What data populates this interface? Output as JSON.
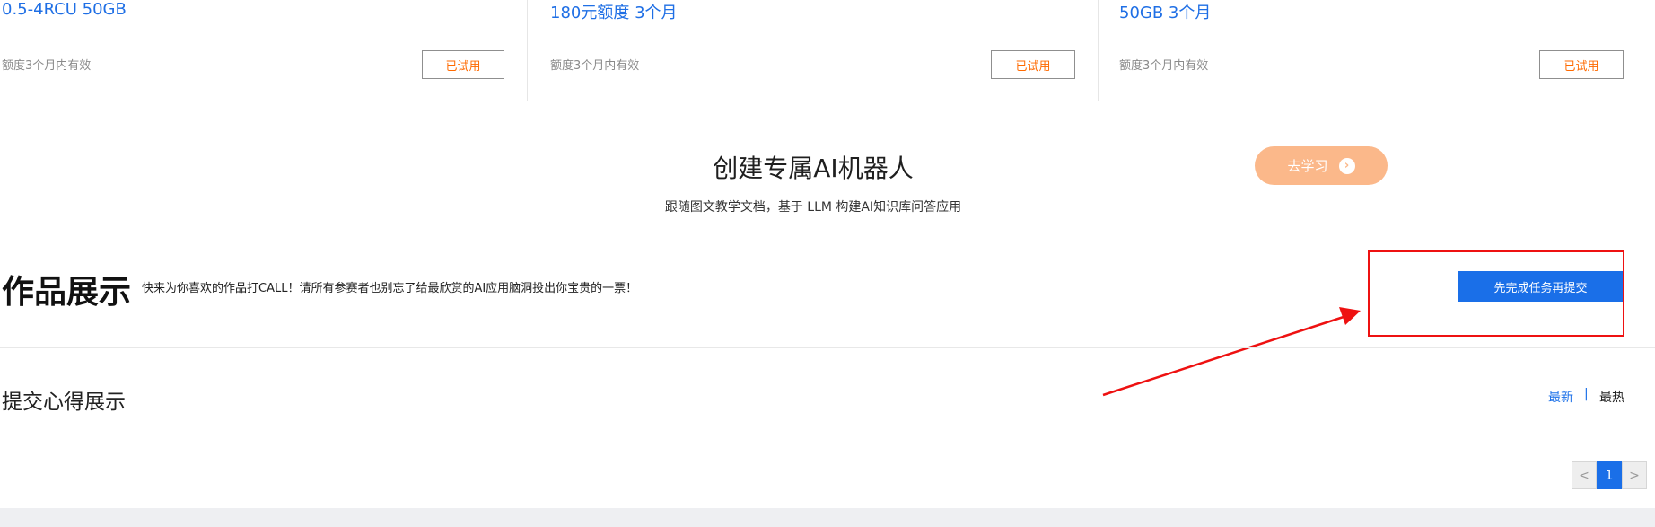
{
  "cards": [
    {
      "title": "0.5-4RCU 50GB",
      "note": "额度3个月内有效",
      "button": "已试用"
    },
    {
      "title": "180元额度 3个月",
      "note": "额度3个月内有效",
      "button": "已试用"
    },
    {
      "title": "50GB 3个月",
      "note": "额度3个月内有效",
      "button": "已试用"
    }
  ],
  "promo": {
    "title": "创建专属AI机器人",
    "subtitle": "跟随图文教学文档，基于 LLM 构建AI知识库问答应用",
    "button": "去学习",
    "button_icon": "chevron-right-icon"
  },
  "works": {
    "title": "作品展示",
    "description": "快来为你喜欢的作品打CALL！请所有参赛者也别忘了给最欣赏的AI应用脑洞投出你宝贵的一票！",
    "submit_button": "先完成任务再提交"
  },
  "experience": {
    "title": "提交心得展示",
    "sort_latest": "最新",
    "sort_separator": "|",
    "sort_hot": "最热"
  },
  "pagination": {
    "prev": "<",
    "current_page": "1",
    "next": ">"
  },
  "colors": {
    "accent_blue": "#1a6fe8",
    "orange_text": "#ff6a00",
    "learn_button": "#fbb88a",
    "annotation_red": "#ee1111"
  }
}
